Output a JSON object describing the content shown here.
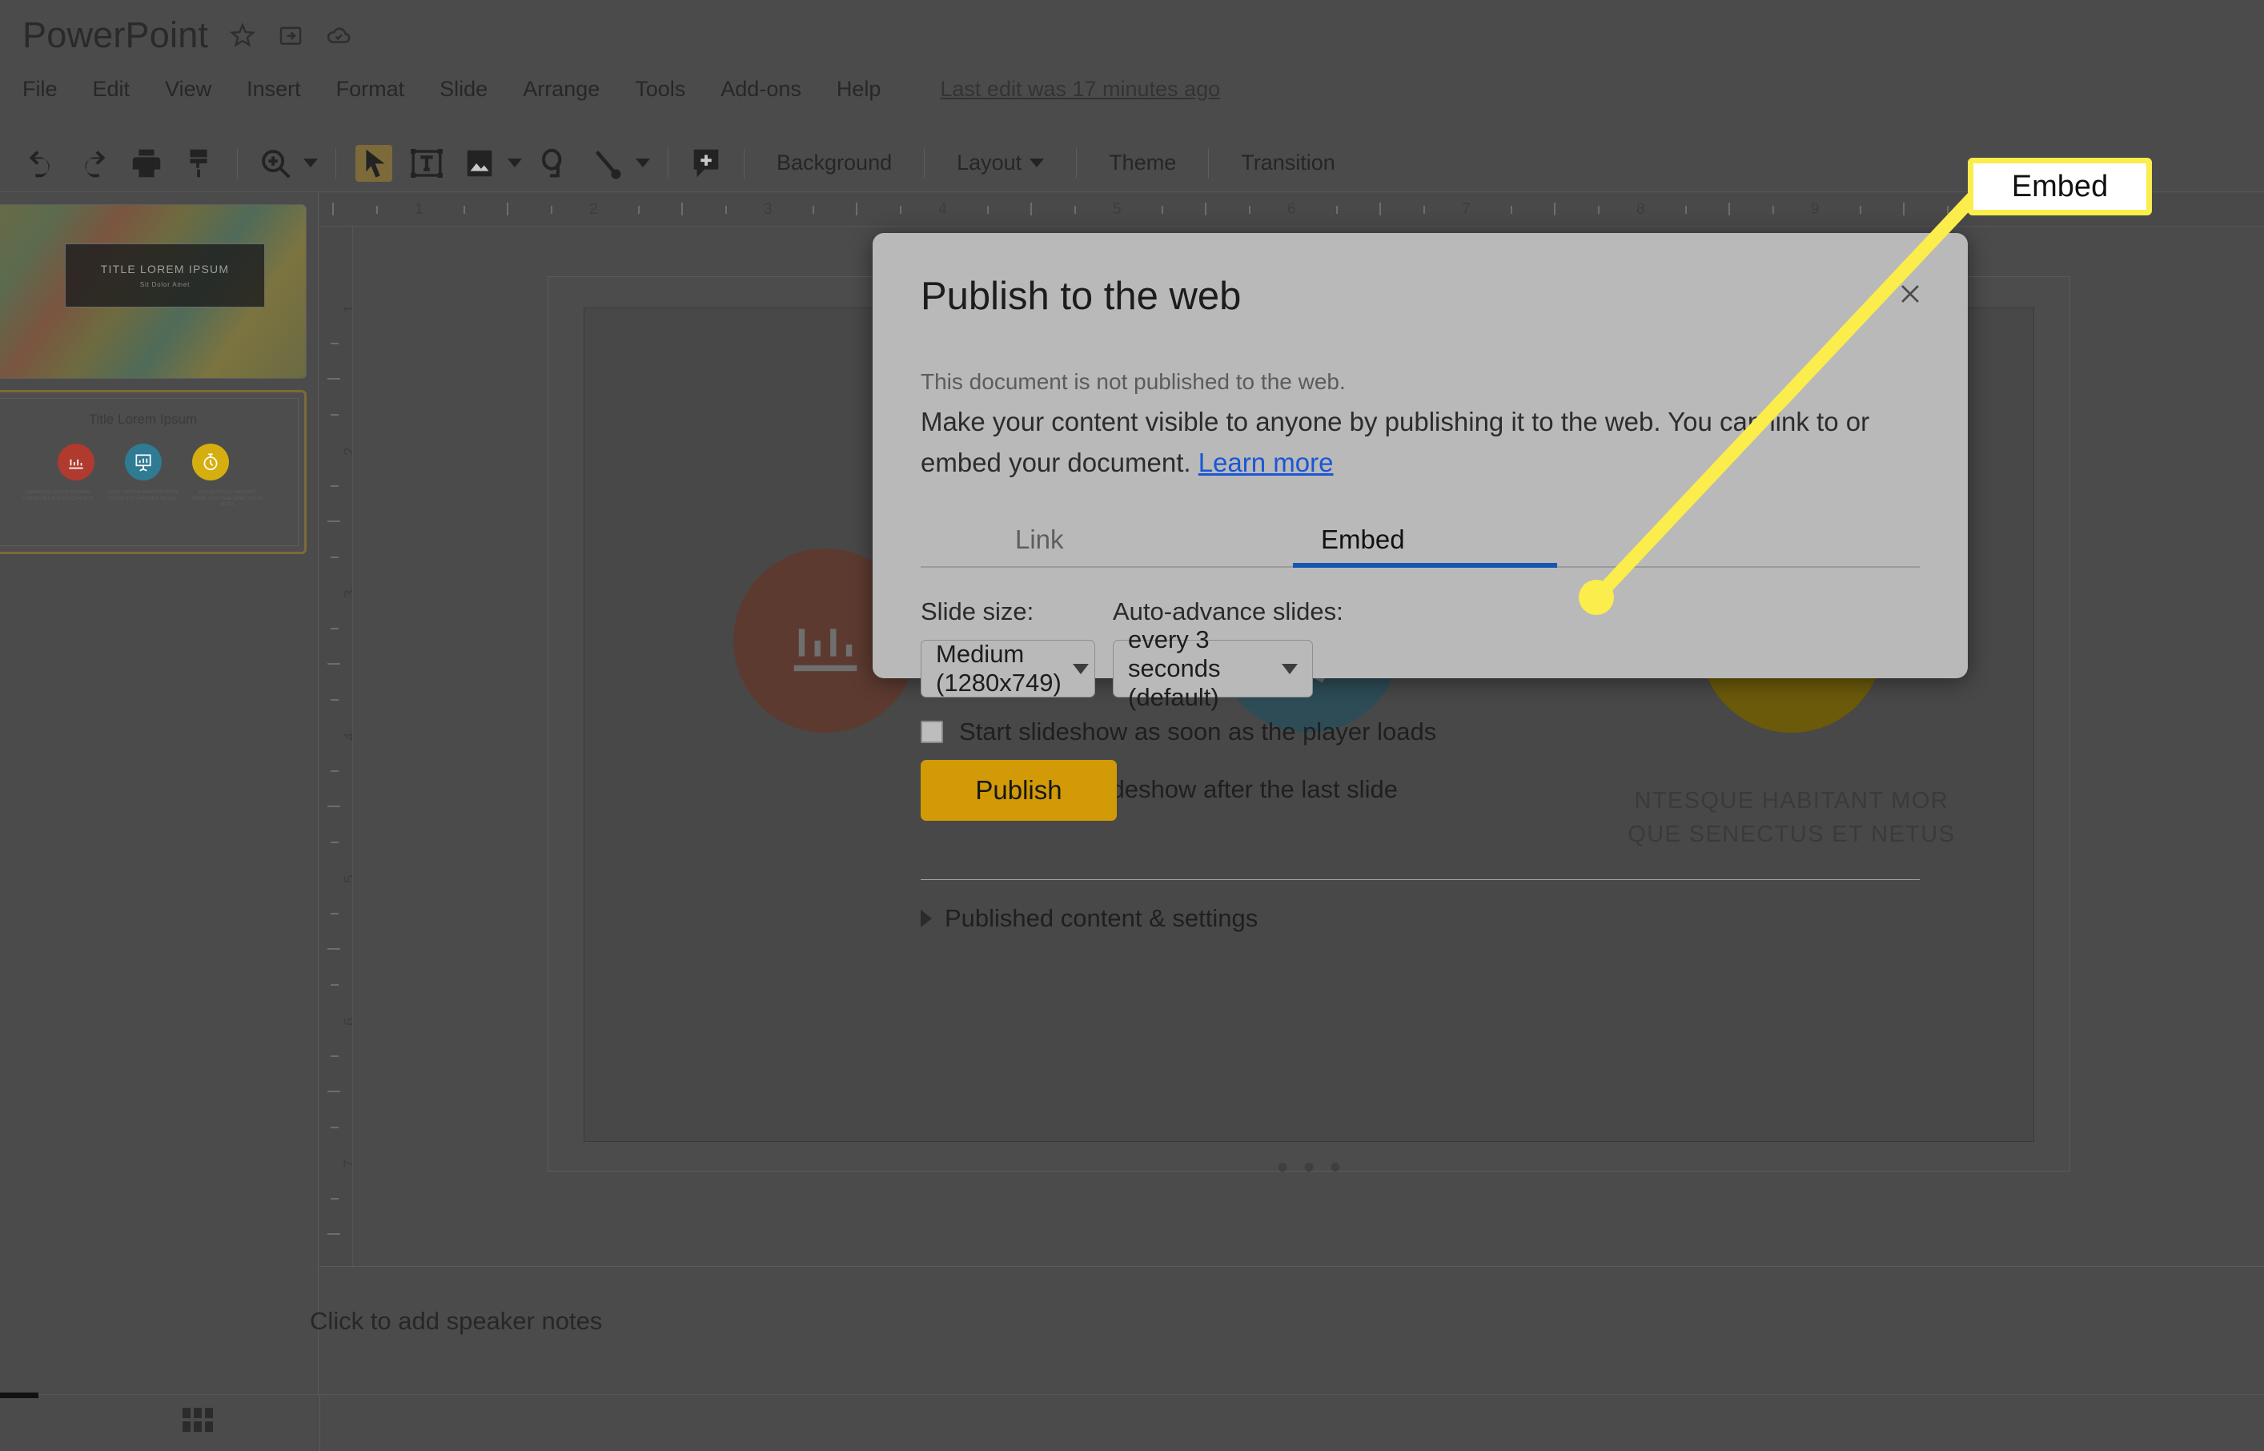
{
  "app": {
    "doc_title": "PowerPoint",
    "header_icons": [
      "star-icon",
      "move-to-folder-icon",
      "cloud-saved-icon"
    ],
    "menus": [
      "File",
      "Edit",
      "View",
      "Insert",
      "Format",
      "Slide",
      "Arrange",
      "Tools",
      "Add-ons",
      "Help"
    ],
    "last_edit": "Last edit was 17 minutes ago"
  },
  "toolbar": {
    "icons": [
      "undo-icon",
      "redo-icon",
      "print-icon",
      "paint-format-icon",
      "zoom-icon",
      "select-icon",
      "textbox-icon",
      "image-icon",
      "shape-icon",
      "line-icon",
      "comment-icon"
    ],
    "buttons": [
      "Background",
      "Layout",
      "Theme",
      "Transition"
    ]
  },
  "ruler": {
    "horizontal_marks": [
      "1",
      "2",
      "3",
      "4",
      "5",
      "6",
      "7",
      "8",
      "9"
    ],
    "vertical_marks": [
      "1",
      "2",
      "3",
      "4",
      "5",
      "6",
      "7"
    ]
  },
  "slides": [
    {
      "index": 1,
      "title": "TITLE LOREM IPSUM",
      "subtitle": "Sit Dolor Amet"
    },
    {
      "index": 2,
      "title": "Title Lorem Ipsum",
      "captions": [
        "LOREM IPSU DOLOR SIT AMET CONSECTETUR ADIPISCING ELIT",
        "NUNC VIVERRA IMPERDIET ENIM FUSCE EST VIVAMUS A TELLUS",
        "PELLENTESQUE HABITANT MORBI TRISTIQUE SENECTUS ET NETUS"
      ],
      "icon_colors": [
        "#b03a2e",
        "#2e7b93",
        "#d5ae10"
      ]
    }
  ],
  "canvas": {
    "slide_title": "Title Lorem Ipsum",
    "column_text": "NTESQUE HABITANT MOR\nQUE SENECTUS ET NETUS",
    "stopwatch_color": "#6b5a0a"
  },
  "notes": {
    "placeholder": "Click to add speaker notes"
  },
  "statusbar": {
    "grid_view_icon": "grid-view-icon"
  },
  "dialog": {
    "title": "Publish to the web",
    "close_icon": "close-icon",
    "status_text": "This document is not published to the web.",
    "description_before_link": "Make your content visible to anyone by publishing it to the web. You can link to or embed your document. ",
    "link_label": "Learn more",
    "tabs": [
      {
        "label": "Link",
        "active": false
      },
      {
        "label": "Embed",
        "active": true
      }
    ],
    "slide_size_label": "Slide size:",
    "slide_size_value": "Medium (1280x749)",
    "auto_advance_label": "Auto-advance slides:",
    "auto_advance_value": "every 3 seconds (default)",
    "checkbox_1": "Start slideshow as soon as the player loads",
    "checkbox_2": "Restart the slideshow after the last slide",
    "publish_button": "Publish",
    "expander_label": "Published content & settings",
    "accent_blue": "#1557b0",
    "publish_yellow": "#d19a06"
  },
  "annotation": {
    "callout_label": "Embed",
    "highlight_color": "#fbed4b"
  }
}
